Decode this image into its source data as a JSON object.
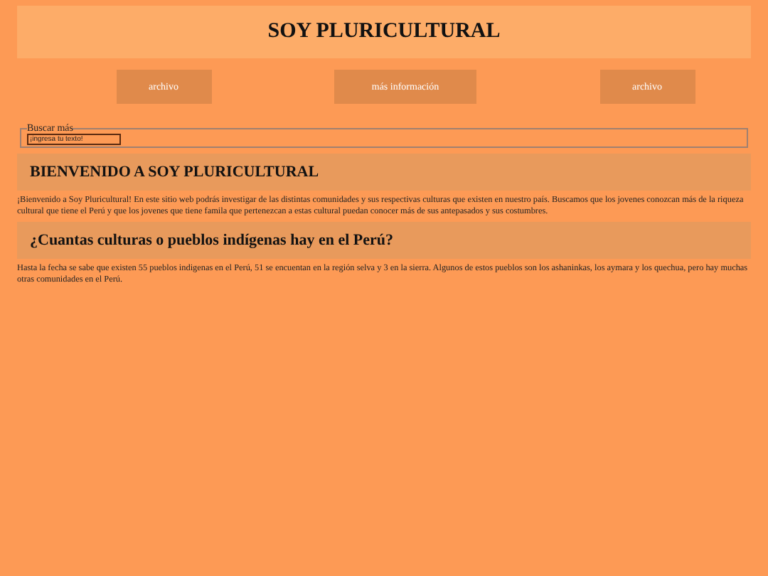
{
  "header": {
    "title": "SOY PLURICULTURAL"
  },
  "nav": [
    "archivo",
    "más información",
    "archivo"
  ],
  "search": {
    "legend": "Buscar más",
    "placeholder": "¡ingresa tu texto!"
  },
  "sections": [
    {
      "heading": "BIENVENIDO A SOY PLURICULTURAL",
      "text": "¡Bienvenido a Soy Pluricultural! En este sitio web podrás investigar de las distintas comunidades y sus respectivas culturas que existen en nuestro país. Buscamos que los jovenes conozcan más de la riqueza cultural que tiene el Perú y que los jovenes que tiene famila que pertenezcan a estas cultural puedan conocer más de sus antepasados y sus costumbres."
    },
    {
      "heading": "¿Cuantas culturas o pueblos indígenas hay en el Perú?",
      "text": "Hasta la fecha se sabe que existen 55 pueblos indigenas en el Perú, 51 se encuentan en la región selva y 3 en la sierra. Algunos de estos pueblos son los ashaninkas, los aymara y los quechua, pero hay muchas otras comunidades en el Perú."
    }
  ]
}
